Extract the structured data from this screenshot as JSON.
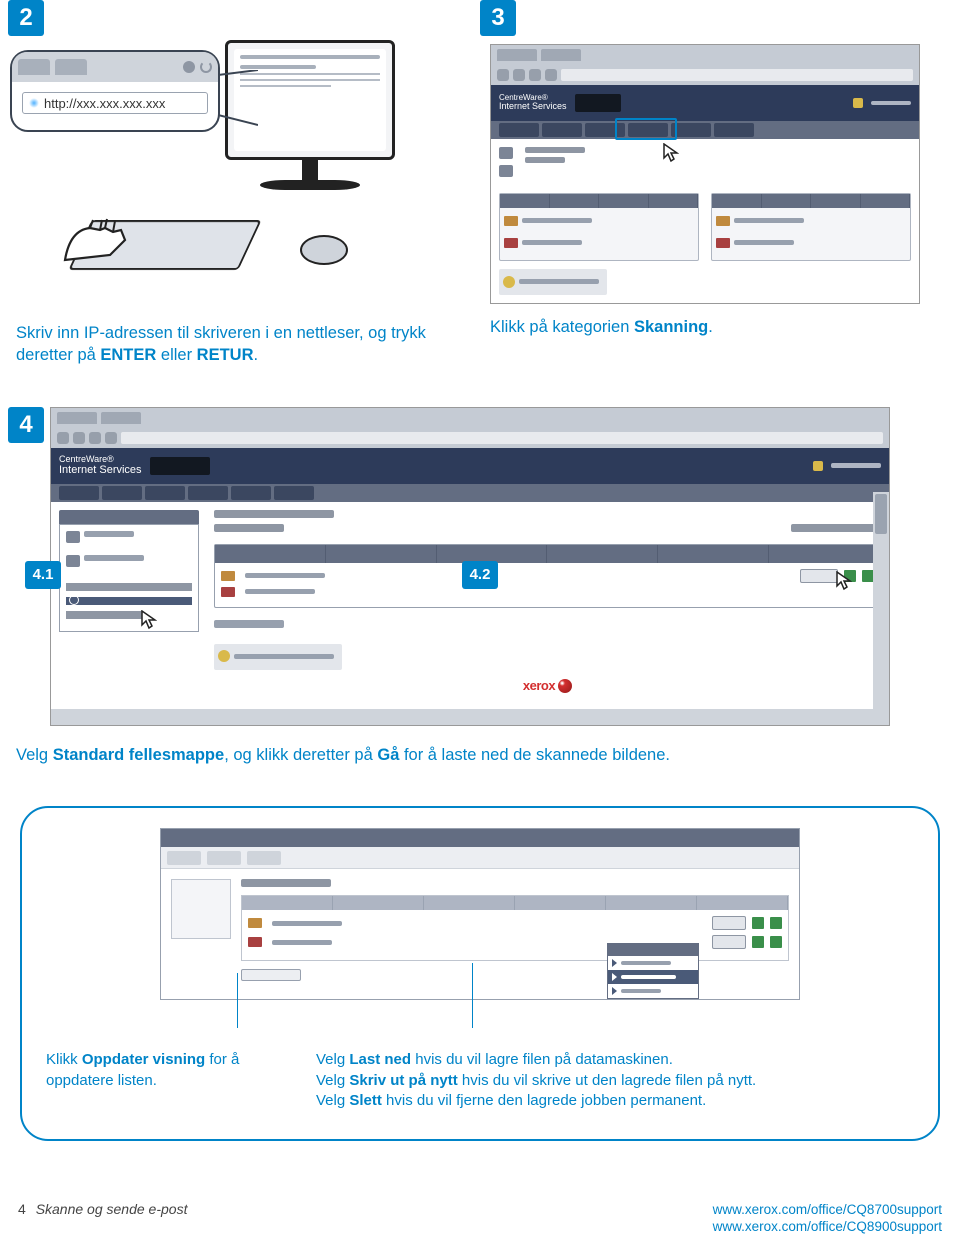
{
  "steps": {
    "s2": "2",
    "s3": "3",
    "s4": "4",
    "s41": "4.1",
    "s42": "4.2"
  },
  "callout": {
    "url": "http://xxx.xxx.xxx.xxx"
  },
  "browser_header": {
    "line1": "CentreWare®",
    "line2": "Internet Services"
  },
  "instructions": {
    "step2": "Skriv inn IP-adressen til skriveren i en nettleser, og trykk deretter på ENTER eller RETUR.",
    "step2_strong1": "ENTER",
    "step2_strong2": "RETUR",
    "step2_pre": "Skriv inn IP-adressen til skriveren i en nettleser, og trykk deretter på ",
    "step2_mid": " eller ",
    "step2_post": ".",
    "step3_pre": "Klikk på kategorien ",
    "step3_strong": "Skanning",
    "step3_post": ".",
    "step4_pre": "Velg ",
    "step4_s1": "Standard fellesmappe",
    "step4_mid": ", og klikk deretter på ",
    "step4_s2": "Gå",
    "step4_post": " for å laste ned de skannede bildene.",
    "detail_left_pre": "Klikk ",
    "detail_left_strong": "Oppdater visning",
    "detail_left_post": " for å oppdatere listen.",
    "dr1_pre": "Velg ",
    "dr1_strong": "Last ned",
    "dr1_post": " hvis du vil lagre filen på datamaskinen.",
    "dr2_pre": "Velg ",
    "dr2_strong": "Skriv ut på nytt",
    "dr2_post": " hvis du vil skrive ut den lagrede filen på nytt.",
    "dr3_pre": "Velg ",
    "dr3_strong": "Slett",
    "dr3_post": " hvis du vil fjerne den lagrede jobben permanent."
  },
  "logo": "xerox",
  "footer": {
    "page": "4",
    "title": "Skanne og sende e-post",
    "url1": "www.xerox.com/office/CQ8700support",
    "url2": "www.xerox.com/office/CQ8900support"
  }
}
